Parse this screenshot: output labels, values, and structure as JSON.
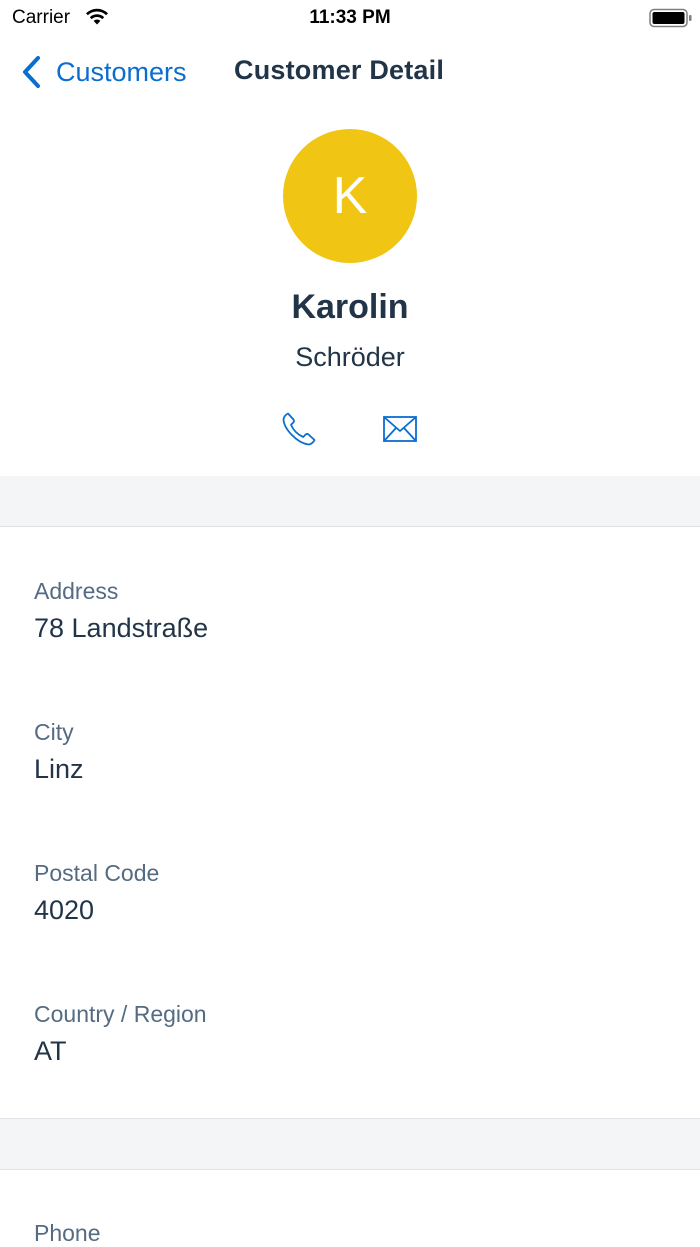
{
  "status_bar": {
    "carrier": "Carrier",
    "time": "11:33 PM"
  },
  "nav": {
    "back_label": "Customers",
    "title": "Customer Detail"
  },
  "profile": {
    "initial": "K",
    "first_name": "Karolin",
    "last_name": "Schröder",
    "avatar_color": "#f0c514"
  },
  "fields": [
    {
      "label": "Address",
      "value": "78 Landstraße"
    },
    {
      "label": "City",
      "value": "Linz"
    },
    {
      "label": "Postal Code",
      "value": "4020"
    },
    {
      "label": "Country / Region",
      "value": "AT"
    }
  ],
  "contact": {
    "phone_label": "Phone"
  },
  "colors": {
    "accent": "#0a6ed1",
    "text_primary": "#223548",
    "text_secondary": "#556b82",
    "section_bg": "#f3f5f7"
  },
  "icons": [
    "wifi-icon",
    "battery-icon",
    "chevron-left-icon",
    "phone-icon",
    "email-icon"
  ]
}
